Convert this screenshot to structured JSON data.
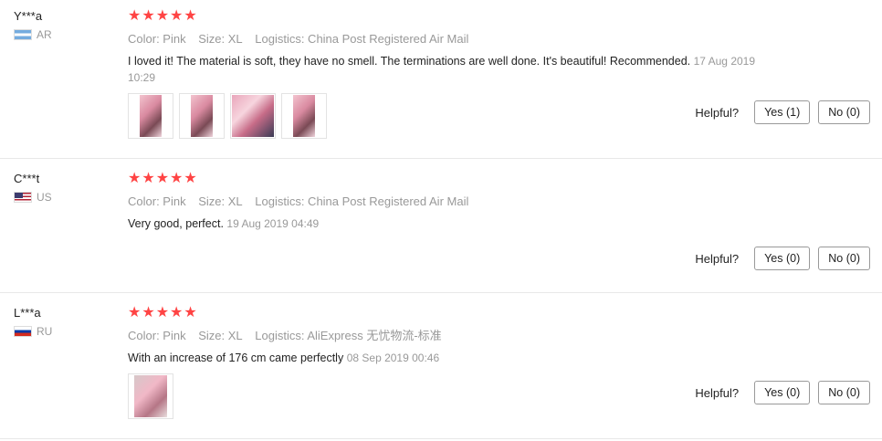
{
  "reviews": [
    {
      "user": "Y***a",
      "country": "AR",
      "rating": 5,
      "color": "Color: Pink",
      "size": "Size: XL",
      "logistics": "Logistics: China Post Registered Air Mail",
      "text": "I loved it! The material is soft, they have no smell. The terminations are well done. It's beautiful! Recommended.",
      "date": "17 Aug 2019 10:29",
      "photo_count": 4,
      "helpful_label": "Helpful?",
      "yes_label": "Yes (1)",
      "no_label": "No (0)"
    },
    {
      "user": "C***t",
      "country": "US",
      "rating": 5,
      "color": "Color: Pink",
      "size": "Size: XL",
      "logistics": "Logistics: China Post Registered Air Mail",
      "text": "Very good, perfect.",
      "date": "19 Aug 2019 04:49",
      "photo_count": 0,
      "helpful_label": "Helpful?",
      "yes_label": "Yes (0)",
      "no_label": "No (0)"
    },
    {
      "user": "L***a",
      "country": "RU",
      "rating": 5,
      "color": "Color: Pink",
      "size": "Size: XL",
      "logistics": "Logistics: AliExpress 无忧物流-标准",
      "text": "With an increase of 176 cm came perfectly",
      "date": "08 Sep 2019 00:46",
      "photo_count": 1,
      "helpful_label": "Helpful?",
      "yes_label": "Yes (0)",
      "no_label": "No (0)"
    }
  ],
  "colors": {
    "star": "#ff4444",
    "muted": "#999999"
  },
  "icons": {
    "star": "star-icon",
    "flag": "country-flag-icon",
    "photo": "review-photo-thumbnail"
  }
}
